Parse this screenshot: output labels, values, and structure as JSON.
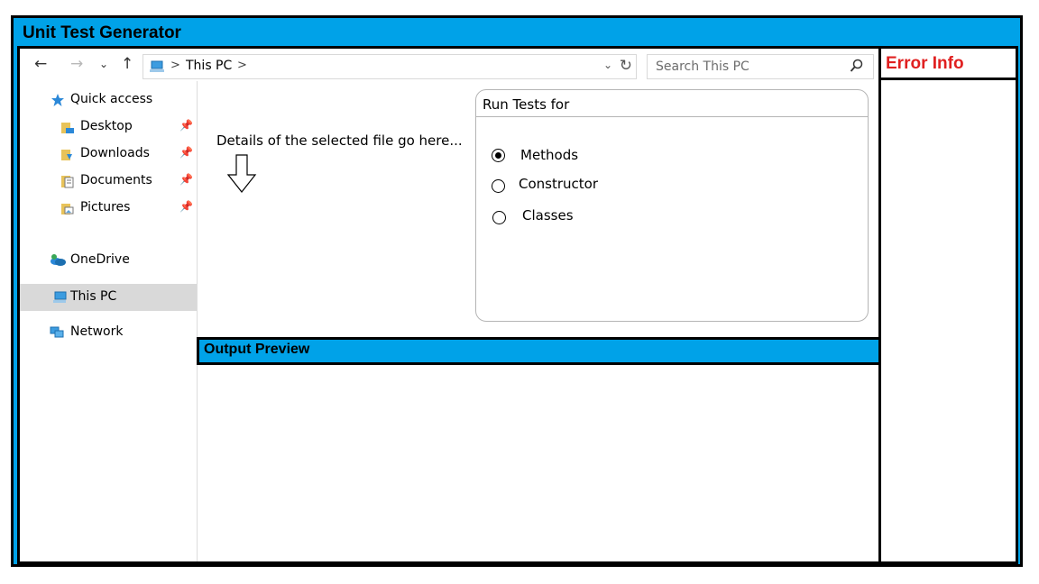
{
  "app": {
    "title": "Unit Test Generator"
  },
  "error_panel": {
    "title": "Error Info"
  },
  "nav": {
    "address_crumb": "This PC",
    "search_placeholder": "Search This PC"
  },
  "sidebar": {
    "items": [
      {
        "label": "Quick access",
        "icon": "star-icon"
      },
      {
        "label": "Desktop",
        "icon": "desktop-folder-icon",
        "pinned": true
      },
      {
        "label": "Downloads",
        "icon": "downloads-folder-icon",
        "pinned": true
      },
      {
        "label": "Documents",
        "icon": "documents-folder-icon",
        "pinned": true
      },
      {
        "label": "Pictures",
        "icon": "pictures-folder-icon",
        "pinned": true
      },
      {
        "label": "OneDrive",
        "icon": "onedrive-icon"
      },
      {
        "label": "This PC",
        "icon": "computer-icon",
        "selected": true
      },
      {
        "label": "Network",
        "icon": "network-icon"
      }
    ]
  },
  "main": {
    "details_text": "Details of the selected file go here...",
    "run_tests": {
      "title": "Run Tests for",
      "options": [
        {
          "label": "Methods",
          "checked": true
        },
        {
          "label": "Constructor",
          "checked": false
        },
        {
          "label": "Classes",
          "checked": false
        }
      ]
    },
    "output_title": "Output Preview"
  },
  "colors": {
    "accent": "#00A2E8",
    "error": "#e02020",
    "selected": "#d9d9d9"
  }
}
